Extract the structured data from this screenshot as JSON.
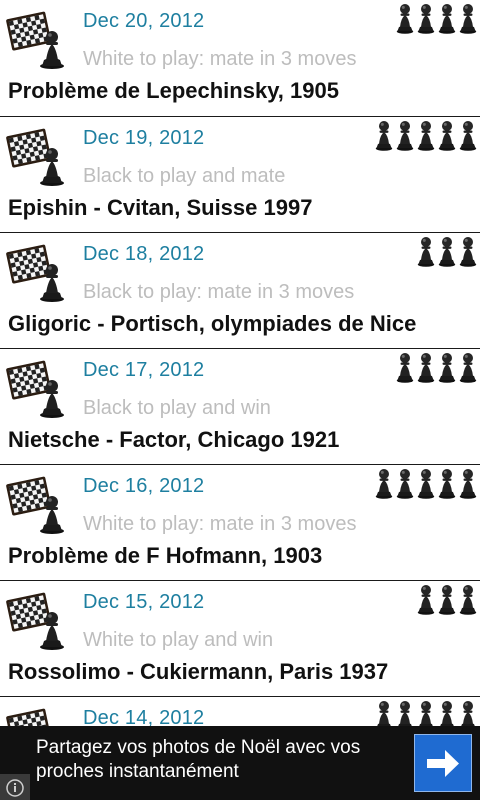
{
  "puzzles": [
    {
      "date": "Dec 20, 2012",
      "description": "White to play: mate in 3 moves",
      "title": "Problème de Lepechinsky, 1905",
      "difficulty": 4
    },
    {
      "date": "Dec 19, 2012",
      "description": "Black to play and mate",
      "title": "Epishin - Cvitan, Suisse 1997",
      "difficulty": 5
    },
    {
      "date": "Dec 18, 2012",
      "description": "Black to play: mate in 3 moves",
      "title": "Gligoric - Portisch, olympiades de Nice",
      "difficulty": 3
    },
    {
      "date": "Dec 17, 2012",
      "description": "Black to play and win",
      "title": "Nietsche - Factor, Chicago 1921",
      "difficulty": 4
    },
    {
      "date": "Dec 16, 2012",
      "description": "White to play: mate in 3 moves",
      "title": "Problème de F Hofmann, 1903",
      "difficulty": 5
    },
    {
      "date": "Dec 15, 2012",
      "description": "White to play and win",
      "title": "Rossolimo - Cukiermann, Paris 1937",
      "difficulty": 3
    },
    {
      "date": "Dec 14, 2012",
      "description": "",
      "title": "",
      "difficulty": 5
    }
  ],
  "ad": {
    "text": "Partagez vos photos de Noël avec vos proches instantanément",
    "button_icon": "arrow-right-icon",
    "info_icon": "info-icon"
  },
  "colors": {
    "date": "#1e7fa0",
    "description": "#bdbdbd",
    "ad_bg": "#111111",
    "ad_button": "#1f6bd1"
  }
}
